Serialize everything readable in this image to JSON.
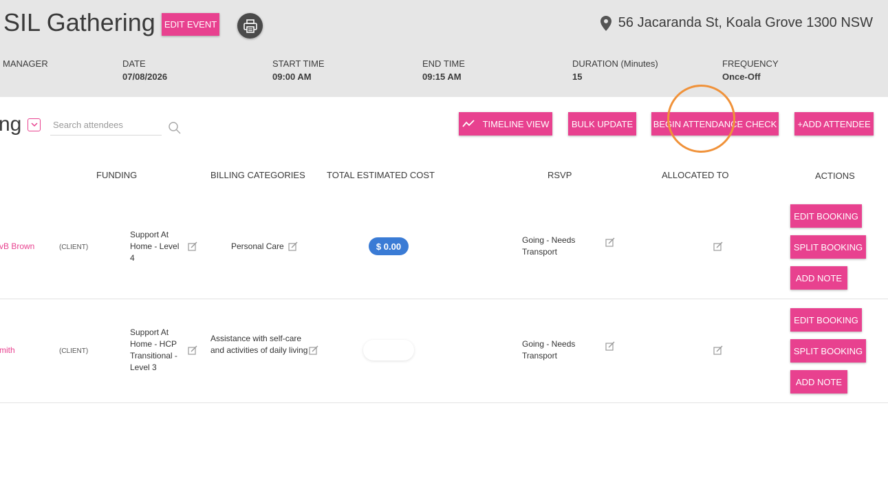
{
  "event": {
    "title": "SIL Gathering",
    "edit_label": "EDIT EVENT",
    "location": "56 Jacaranda St, Koala Grove 1300 NSW"
  },
  "meta": {
    "manager_label": "MANAGER",
    "date_label": "DATE",
    "date_value": "07/08/2026",
    "start_label": "START TIME",
    "start_value": "09:00 AM",
    "end_label": "END TIME",
    "end_value": "09:15 AM",
    "duration_label": "DURATION (Minutes)",
    "duration_value": "15",
    "frequency_label": "FREQUENCY",
    "frequency_value": "Once-Off"
  },
  "toolbar": {
    "title_fragment": "ng",
    "search_placeholder": "Search attendees",
    "timeline_label": "TIMELINE VIEW",
    "bulk_label": "BULK UPDATE",
    "attendance_label": "BEGIN ATTENDANCE CHECK",
    "add_attendee_label": "+ADD ATTENDEE"
  },
  "columns": {
    "funding": "FUNDING",
    "billing": "BILLING CATEGORIES",
    "cost": "TOTAL ESTIMATED COST",
    "rsvp": "RSVP",
    "allocated": "ALLOCATED TO",
    "actions": "ACTIONS"
  },
  "rows": [
    {
      "name": "vB Brown",
      "type": "(CLIENT)",
      "funding": "Support At Home - Level 4",
      "billing": "Personal Care",
      "cost": "$ 0.00",
      "rsvp": "Going - Needs Transport",
      "edit_booking": "EDIT BOOKING",
      "split_booking": "SPLIT BOOKING",
      "add_note": "ADD NOTE"
    },
    {
      "name": "mith",
      "type": "(CLIENT)",
      "funding": "Support At Home - HCP Transitional - Level 3",
      "billing": "Assistance with self-care and activities of daily living",
      "cost": "",
      "rsvp": "Going - Needs Transport",
      "edit_booking": "EDIT BOOKING",
      "split_booking": "SPLIT BOOKING",
      "add_note": "ADD NOTE"
    }
  ],
  "colors": {
    "accent": "#e8418f",
    "cost_pill": "#3a7bd5",
    "header_bg": "#e6e6e6",
    "click_ring": "#f0923a"
  },
  "icons": [
    "location-pin-icon",
    "printer-icon",
    "chevron-down-icon",
    "search-icon",
    "trend-line-icon",
    "edit-icon"
  ]
}
